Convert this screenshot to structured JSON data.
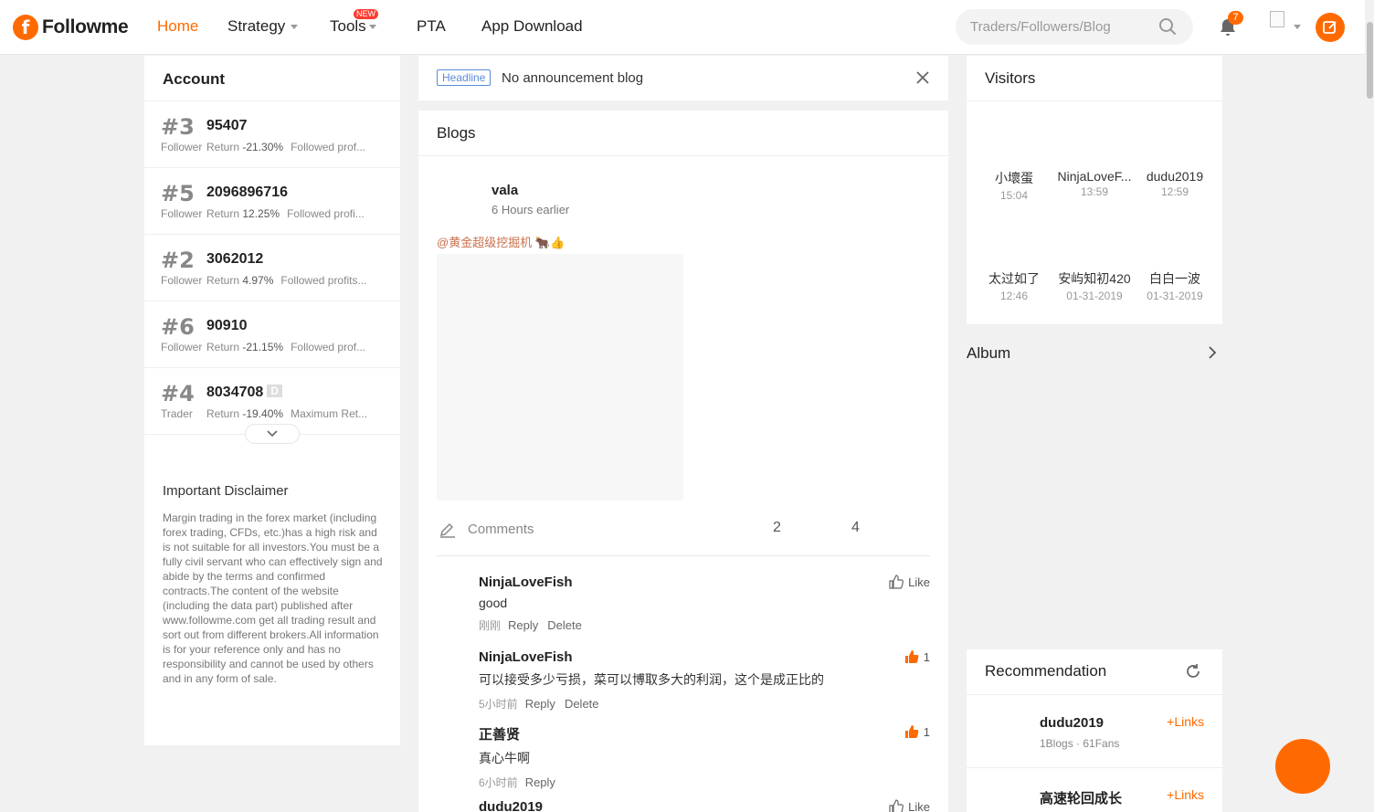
{
  "brand": {
    "name": "Followme"
  },
  "nav": {
    "items": [
      {
        "label": "Home",
        "active": true
      },
      {
        "label": "Strategy",
        "dropdown": true
      },
      {
        "label": "Tools",
        "dropdown": true,
        "badge": "NEW"
      },
      {
        "label": "PTA"
      },
      {
        "label": "App Download"
      }
    ],
    "search_placeholder": "Traders/Followers/Blog",
    "notification_count": "7"
  },
  "account": {
    "title": "Account",
    "rows": [
      {
        "rank": "#3",
        "id": "95407",
        "role": "Follower",
        "return_label": "Return",
        "return_value": "-21.30%",
        "extra": "Followed prof..."
      },
      {
        "rank": "#5",
        "id": "2096896716",
        "role": "Follower",
        "return_label": "Return",
        "return_value": "12.25%",
        "extra": "Followed profi..."
      },
      {
        "rank": "#2",
        "id": "3062012",
        "role": "Follower",
        "return_label": "Return",
        "return_value": "4.97%",
        "extra": "Followed profits..."
      },
      {
        "rank": "#6",
        "id": "90910",
        "role": "Follower",
        "return_label": "Return",
        "return_value": "-21.15%",
        "extra": "Followed prof..."
      },
      {
        "rank": "#4",
        "id": "8034708",
        "badge": "D",
        "role": "Trader",
        "return_label": "Return",
        "return_value": "-19.40%",
        "extra": "Maximum Ret..."
      }
    ]
  },
  "disclaimer": {
    "title": "Important Disclaimer",
    "body": "Margin trading in the forex market (including forex trading, CFDs, etc.)has a high risk and is not suitable for all investors.You must be a fully civil servant who can effectively sign and abide by the terms and confirmed contracts.The content of the website (including the data part) published after www.followme.com get all trading result and sort out from different brokers.All information is for your reference only and has no responsibility and cannot be used by others and in any form of sale."
  },
  "headline": {
    "tag": "Headline",
    "text": "No announcement blog"
  },
  "blogs": {
    "title": "Blogs",
    "post": {
      "author": "vala",
      "time": "6 Hours earlier",
      "mention": "@黄金超级挖掘机 🐂👍",
      "comments_label": "Comments",
      "count_a": "2",
      "count_b": "4"
    },
    "comments": [
      {
        "author": "NinjaLoveFish",
        "text": "good",
        "time": "刚刚",
        "reply": "Reply",
        "delete": "Delete",
        "like": "Like",
        "liked": false
      },
      {
        "author": "NinjaLoveFish",
        "text": "可以接受多少亏损，菜可以博取多大的利润，这个是成正比的",
        "time": "5小时前",
        "reply": "Reply",
        "delete": "Delete",
        "like": "1",
        "liked": true
      },
      {
        "author": "正善贤",
        "text": "真心牛啊",
        "time": "6小时前",
        "reply": "Reply",
        "like": "1",
        "liked": true
      },
      {
        "author": "dudu2019",
        "text": "",
        "time": "",
        "reply": "",
        "like": "Like",
        "liked": false
      }
    ]
  },
  "visitors": {
    "title": "Visitors",
    "list": [
      {
        "name": "小壞蛋",
        "time": "15:04"
      },
      {
        "name": "NinjaLoveF...",
        "time": "13:59"
      },
      {
        "name": "dudu2019",
        "time": "12:59"
      },
      {
        "name": "太过如了",
        "time": "12:46"
      },
      {
        "name": "安屿知初420",
        "time": "01-31-2019"
      },
      {
        "name": "白白一波",
        "time": "01-31-2019"
      }
    ]
  },
  "album": {
    "title": "Album"
  },
  "recommendation": {
    "title": "Recommendation",
    "items": [
      {
        "name": "dudu2019",
        "stats": "1Blogs · 61Fans",
        "link": "Links"
      },
      {
        "name": "高速轮回成长",
        "stats": "",
        "link": "Links"
      }
    ]
  },
  "colors": {
    "accent": "#ff6a00",
    "link_blue": "#5b8bd9",
    "mention": "#c8704d"
  }
}
